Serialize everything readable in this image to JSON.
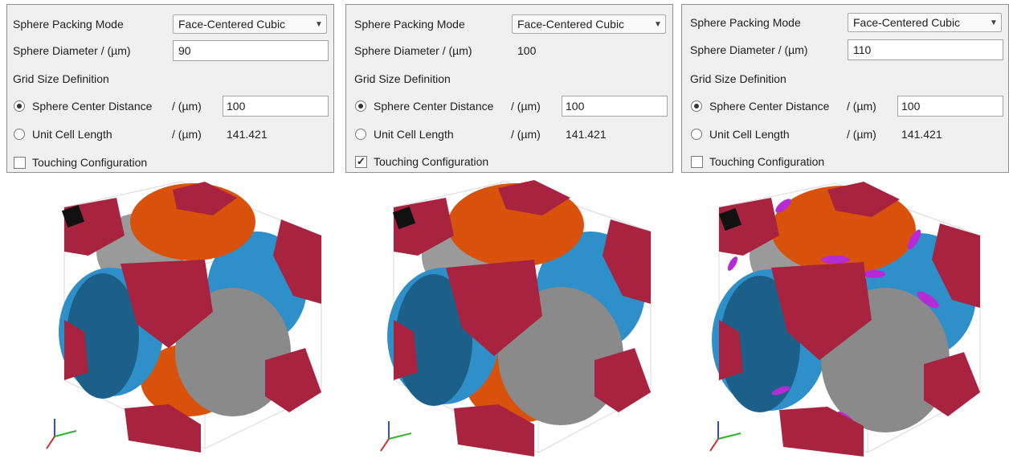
{
  "panels": [
    {
      "packing_label": "Sphere Packing Mode",
      "packing_value": "Face-Centered Cubic",
      "diameter_label": "Sphere Diameter / (µm)",
      "diameter_value": "90",
      "diameter_editable": true,
      "grid_label": "Grid Size Definition",
      "center_label": "Sphere Center Distance",
      "center_unit": "/ (µm)",
      "center_value": "100",
      "cell_label": "Unit Cell Length",
      "cell_unit": "/ (µm)",
      "cell_value": "141.421",
      "touching_label": "Touching Configuration",
      "touching_checked": false
    },
    {
      "packing_label": "Sphere Packing Mode",
      "packing_value": "Face-Centered Cubic",
      "diameter_label": "Sphere Diameter / (µm)",
      "diameter_value": "100",
      "diameter_editable": false,
      "grid_label": "Grid Size Definition",
      "center_label": "Sphere Center Distance",
      "center_unit": "/ (µm)",
      "center_value": "100",
      "cell_label": "Unit Cell Length",
      "cell_unit": "/ (µm)",
      "cell_value": "141.421",
      "touching_label": "Touching Configuration",
      "touching_checked": true
    },
    {
      "packing_label": "Sphere Packing Mode",
      "packing_value": "Face-Centered Cubic",
      "diameter_label": "Sphere Diameter / (µm)",
      "diameter_value": "110",
      "diameter_editable": true,
      "grid_label": "Grid Size Definition",
      "center_label": "Sphere Center Distance",
      "center_unit": "/ (µm)",
      "center_value": "100",
      "cell_label": "Unit Cell Length",
      "cell_unit": "/ (µm)",
      "cell_value": "141.421",
      "touching_label": "Touching Configuration",
      "touching_checked": false
    }
  ],
  "colors": {
    "corner": "#a8233f",
    "corner_dark": "#6e1528",
    "top": "#d9520c",
    "blue": "#2e8fc9",
    "blue_dark": "#1c5f88",
    "gray": "#8a8a8a",
    "gray_dark": "#6d6d6d",
    "contact": "#b52bd6",
    "axis_x": "#d12b2b",
    "axis_y": "#2bb52b",
    "axis_z": "#2b4fd1"
  },
  "icons": [
    "chevron-down-icon",
    "radio-selected-icon",
    "radio-unselected-icon",
    "checkmark-icon",
    "axis-triad-icon"
  ]
}
